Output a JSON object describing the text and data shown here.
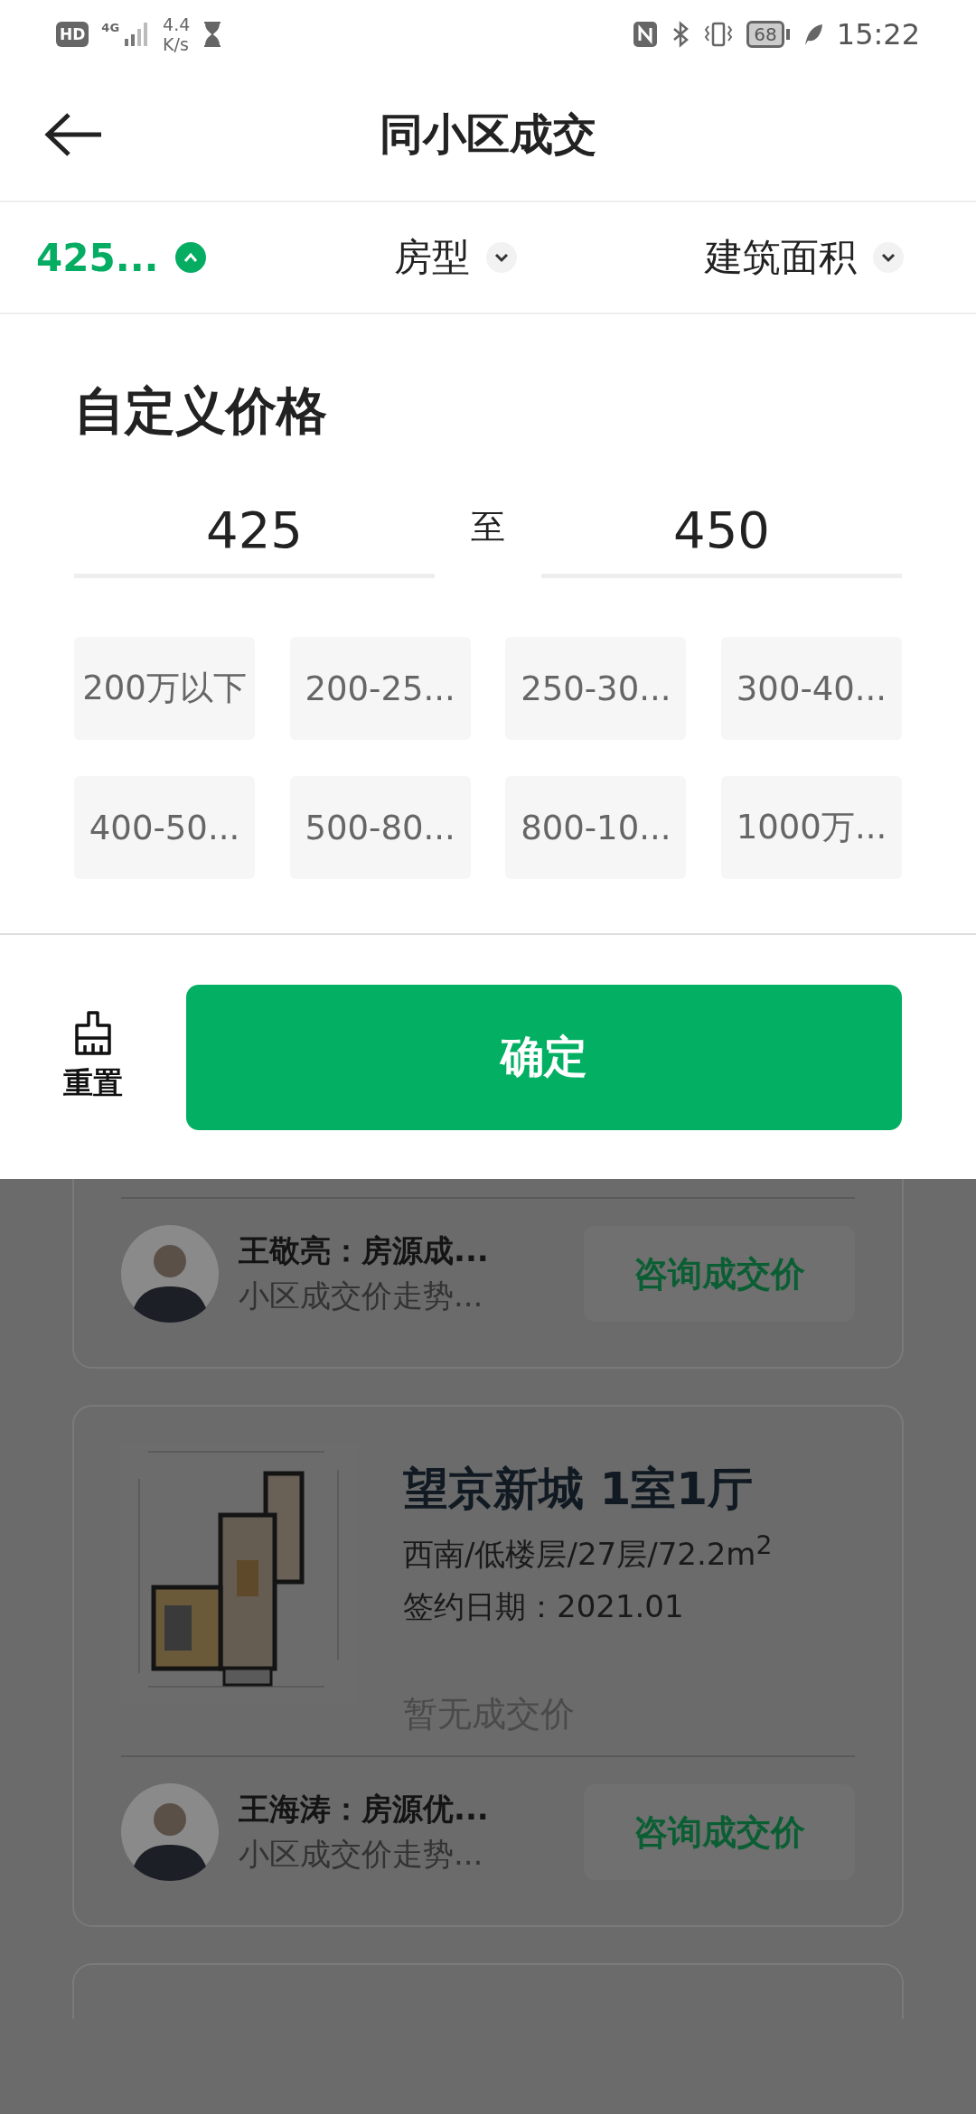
{
  "status_bar": {
    "hd": "HD",
    "network": "4G",
    "speed_value": "4.4",
    "speed_unit": "K/s",
    "battery": "68",
    "time": "15:22"
  },
  "header": {
    "title": "同小区成交"
  },
  "filters": [
    {
      "label": "425...",
      "expanded": true,
      "active": true
    },
    {
      "label": "房型",
      "expanded": false,
      "active": false
    },
    {
      "label": "建筑面积",
      "expanded": false,
      "active": false
    }
  ],
  "price_panel": {
    "title": "自定义价格",
    "min": "425",
    "separator": "至",
    "max": "450",
    "presets": [
      {
        "label": "200万以下",
        "selected": false
      },
      {
        "label": "200-25...",
        "selected": false
      },
      {
        "label": "250-30...",
        "selected": false
      },
      {
        "label": "300-40...",
        "selected": false
      },
      {
        "label": "400-50...",
        "selected": false
      },
      {
        "label": "500-80...",
        "selected": false
      },
      {
        "label": "800-10...",
        "selected": false
      },
      {
        "label": "1000万...",
        "selected": false
      }
    ]
  },
  "footer": {
    "reset": "重置",
    "confirm": "确定"
  },
  "listings": [
    {
      "kind": "agent_only",
      "agent": {
        "name": "王敬亮：房源成...",
        "note": "小区成交价走势...",
        "action": "咨询成交价"
      }
    },
    {
      "kind": "full",
      "title": "望京新城 1室1厅",
      "details": "西南/低楼层/27层/72.2m$^{2}$",
      "signed": "签约日期：2021.01",
      "price": "暂无成交价",
      "agent": {
        "name": "王海涛：房源优...",
        "note": "小区成交价走势...",
        "action": "咨询成交价"
      }
    },
    {
      "kind": "edge"
    }
  ]
}
